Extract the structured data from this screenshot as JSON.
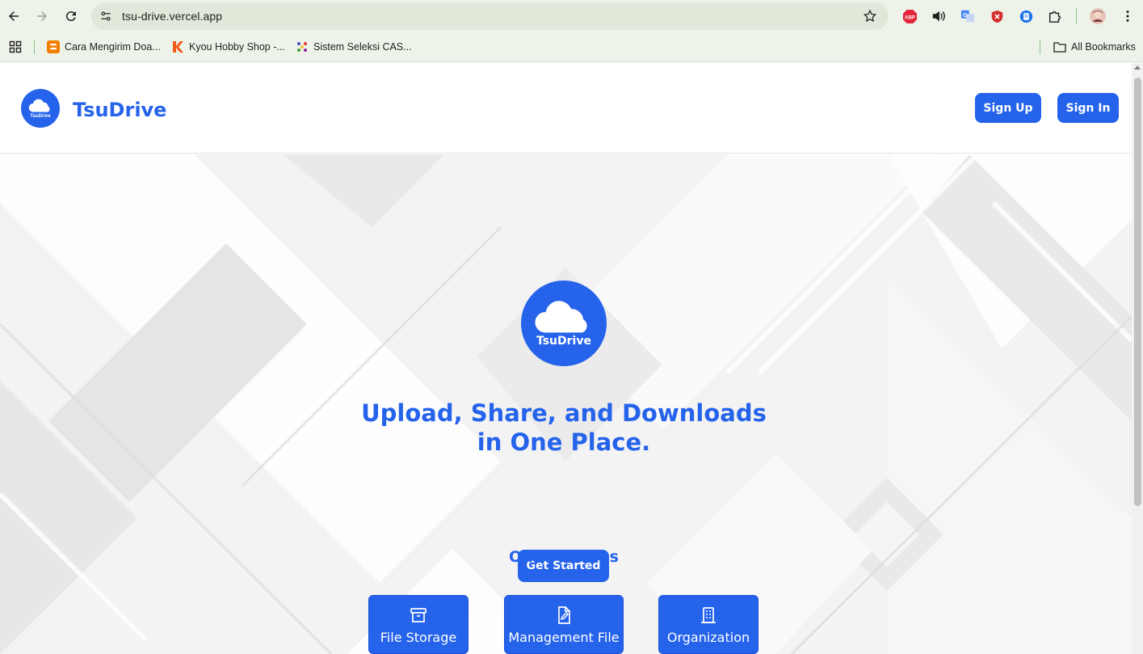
{
  "browser": {
    "url": "tsu-drive.vercel.app",
    "bookmarks": [
      {
        "label": "Cara Mengirim Doa...",
        "icon": "blogger-icon"
      },
      {
        "label": "Kyou Hobby Shop -...",
        "icon": "kyou-icon"
      },
      {
        "label": "Sistem Seleksi CAS...",
        "icon": "seleksi-icon"
      }
    ],
    "all_bookmarks_label": "All Bookmarks",
    "extensions": [
      "adblock-plus-icon",
      "sound-icon",
      "translate-icon",
      "shield-extension-icon",
      "docs-extension-icon",
      "puzzle-icon",
      "profile-avatar",
      "menu-icon"
    ],
    "extension_labels": {
      "adblock": "ABP"
    }
  },
  "header": {
    "logo_text": "TsuDrive",
    "brand": "TsuDrive",
    "signup_label": "Sign Up",
    "signin_label": "Sign In"
  },
  "hero": {
    "logo_text": "TsuDrive",
    "headline_line1": "Upload, Share, and Downloads",
    "headline_line2": "in One Place.",
    "cta_label": "Get Started",
    "services_title": "Our Services",
    "services": [
      {
        "label": "File Storage",
        "icon": "archive-box-icon"
      },
      {
        "label": "Management File",
        "icon": "document-edit-icon"
      },
      {
        "label": "Organization",
        "icon": "building-icon"
      }
    ]
  },
  "colors": {
    "primary": "#2563eb",
    "chrome": "#eef3ea",
    "omnibox": "#dfe8d9"
  }
}
